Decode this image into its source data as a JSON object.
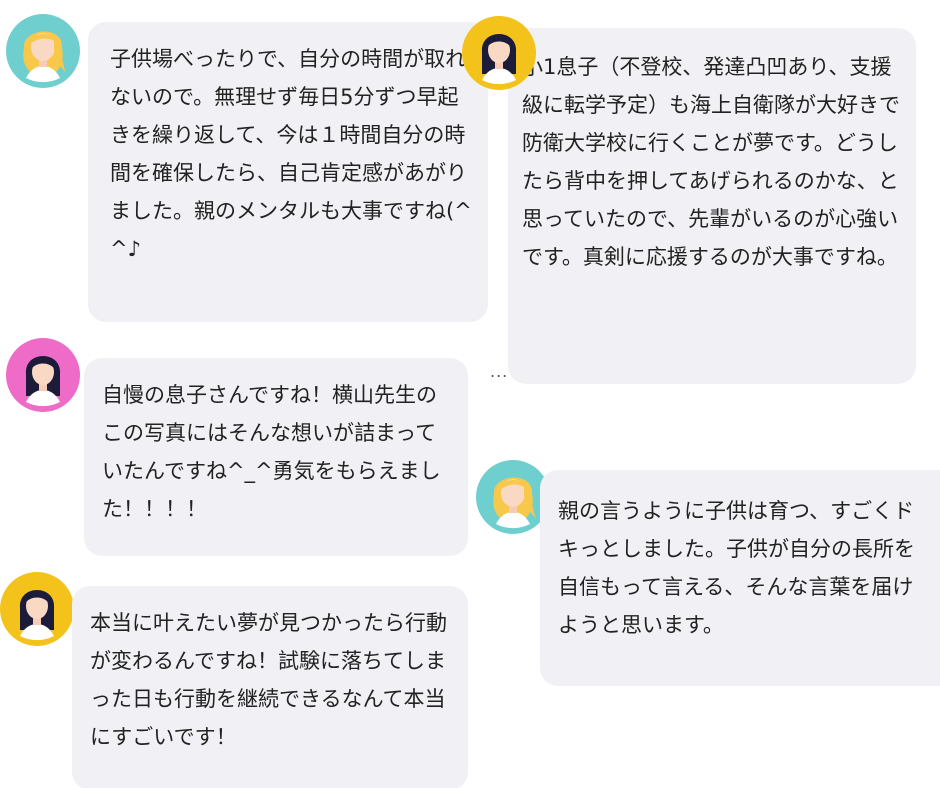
{
  "colors": {
    "bubble_bg": "#f1f1f5",
    "text": "#222222",
    "link_blue": "#2b6fd6",
    "avatar_teal": "#6fcfcf",
    "avatar_yellow": "#f3c21b",
    "avatar_pink": "#ef6bc8"
  },
  "comments": [
    {
      "avatar": "blonde-woman-on-teal-icon",
      "text": "子供場べったりで、自分の時間が取れないので。無理せず毎日5分ずつ早起きを繰り返して、今は１時間自分の時間を確保したら、自己肯定感があがりました。親のメンタルも大事ですね(^^♪"
    },
    {
      "avatar": "dark-haired-woman-on-yellow-icon",
      "text": "小1息子（不登校、発達凸凹あり、支援級に転学予定）も海上自衛隊が大好きで防衛大学校に行くことが夢です。どうしたら背中を押してあげられるのかな、と思っていたので、先輩がいるのが心強いです。真剣に応援するのが大事ですね。"
    },
    {
      "avatar": "dark-haired-woman-on-pink-icon",
      "text": "自慢の息子さんですね！横山先生のこの写真にはそんな想いが詰まっていたんですね^_^勇気をもらえました！！！！"
    },
    {
      "avatar": "blonde-woman-on-teal-icon",
      "text": "親の言うように子供は育つ、すごくドキっとしました。子供が自分の長所を自信もって言える、そんな言葉を届けようと思います。"
    },
    {
      "avatar": "dark-haired-woman-on-yellow-icon",
      "text": "本当に叶えたい夢が見つかったら行動が変わるんですね！試験に落ちてしまった日も行動を継続できるなんて本当にすごいです！"
    }
  ],
  "more_indicator": "..."
}
